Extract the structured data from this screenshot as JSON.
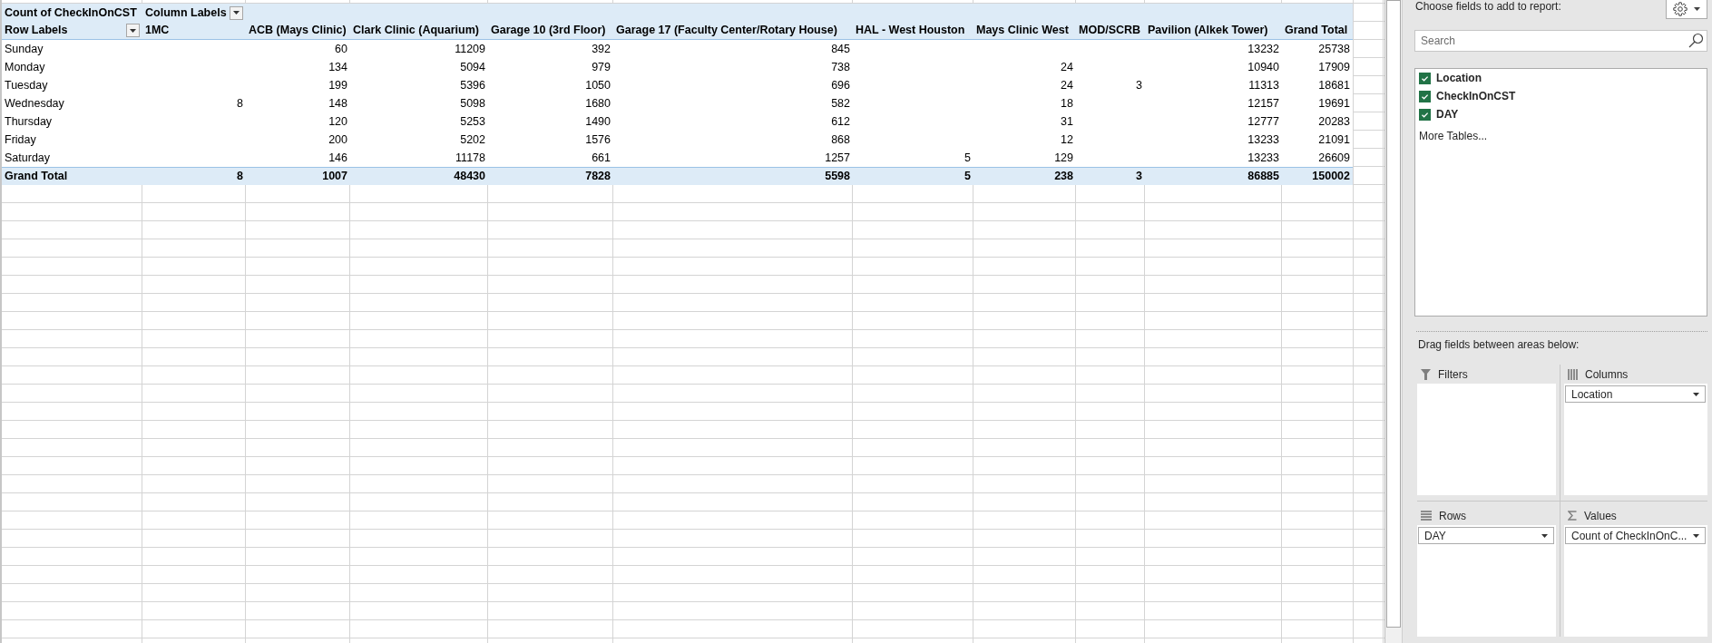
{
  "pivot": {
    "value_field": "Count of CheckInOnCST",
    "column_labels": "Column Labels",
    "row_labels": "Row Labels",
    "columns": {
      "1mc": "1MC",
      "acb_mays_clinic": "ACB (Mays Clinic)",
      "clark_clinic_aquarium": "Clark Clinic (Aquarium)",
      "garage_10_3rd_floor": "Garage 10 (3rd Floor)",
      "garage_17_faculty_center_rotary_house": "Garage 17 (Faculty Center/Rotary House)",
      "hal_west_houston": "HAL - West Houston",
      "mays_clinic_west": "Mays Clinic West",
      "mod_scrb": "MOD/SCRB",
      "pavilion_alkek_tower": "Pavilion (Alkek Tower)",
      "grand_total": "Grand Total"
    },
    "rows": [
      {
        "label": "Sunday",
        "cells": {
          "acb_mays_clinic": "60",
          "clark_clinic_aquarium": "11209",
          "garage_10_3rd_floor": "392",
          "garage_17_faculty_center_rotary_house": "845",
          "pavilion_alkek_tower": "13232",
          "grand_total": "25738"
        }
      },
      {
        "label": "Monday",
        "cells": {
          "acb_mays_clinic": "134",
          "clark_clinic_aquarium": "5094",
          "garage_10_3rd_floor": "979",
          "garage_17_faculty_center_rotary_house": "738",
          "mays_clinic_west": "24",
          "pavilion_alkek_tower": "10940",
          "grand_total": "17909"
        }
      },
      {
        "label": "Tuesday",
        "cells": {
          "acb_mays_clinic": "199",
          "clark_clinic_aquarium": "5396",
          "garage_10_3rd_floor": "1050",
          "garage_17_faculty_center_rotary_house": "696",
          "mays_clinic_west": "24",
          "mod_scrb": "3",
          "pavilion_alkek_tower": "11313",
          "grand_total": "18681"
        }
      },
      {
        "label": "Wednesday",
        "cells": {
          "1mc": "8",
          "acb_mays_clinic": "148",
          "clark_clinic_aquarium": "5098",
          "garage_10_3rd_floor": "1680",
          "garage_17_faculty_center_rotary_house": "582",
          "mays_clinic_west": "18",
          "pavilion_alkek_tower": "12157",
          "grand_total": "19691"
        }
      },
      {
        "label": "Thursday",
        "cells": {
          "acb_mays_clinic": "120",
          "clark_clinic_aquarium": "5253",
          "garage_10_3rd_floor": "1490",
          "garage_17_faculty_center_rotary_house": "612",
          "mays_clinic_west": "31",
          "pavilion_alkek_tower": "12777",
          "grand_total": "20283"
        }
      },
      {
        "label": "Friday",
        "cells": {
          "acb_mays_clinic": "200",
          "clark_clinic_aquarium": "5202",
          "garage_10_3rd_floor": "1576",
          "garage_17_faculty_center_rotary_house": "868",
          "mays_clinic_west": "12",
          "pavilion_alkek_tower": "13233",
          "grand_total": "21091"
        }
      },
      {
        "label": "Saturday",
        "cells": {
          "acb_mays_clinic": "146",
          "clark_clinic_aquarium": "11178",
          "garage_10_3rd_floor": "661",
          "garage_17_faculty_center_rotary_house": "1257",
          "hal_west_houston": "5",
          "mays_clinic_west": "129",
          "pavilion_alkek_tower": "13233",
          "grand_total": "26609"
        }
      }
    ],
    "grand_total": {
      "label": "Grand Total",
      "cells": {
        "1mc": "8",
        "acb_mays_clinic": "1007",
        "clark_clinic_aquarium": "48430",
        "garage_10_3rd_floor": "7828",
        "garage_17_faculty_center_rotary_house": "5598",
        "hal_west_houston": "5",
        "mays_clinic_west": "238",
        "mod_scrb": "3",
        "pavilion_alkek_tower": "86885",
        "grand_total": "150002"
      }
    }
  },
  "field_list": {
    "header": "Choose fields to add to report:",
    "search": {
      "placeholder": "Search"
    },
    "fields": [
      {
        "label": "Location",
        "checked": true
      },
      {
        "label": "CheckInOnCST",
        "checked": true
      },
      {
        "label": "DAY",
        "checked": true
      }
    ],
    "more_tables": "More Tables...",
    "areas_hint": "Drag fields between areas below:",
    "areas": [
      {
        "kind": "filters",
        "title": "Filters"
      },
      {
        "kind": "columns",
        "title": "Columns",
        "items": [
          "Location"
        ]
      },
      {
        "kind": "rows",
        "title": "Rows",
        "items": [
          "DAY"
        ]
      },
      {
        "kind": "values",
        "title": "Values",
        "items": [
          "Count of CheckInOnC..."
        ]
      }
    ]
  }
}
